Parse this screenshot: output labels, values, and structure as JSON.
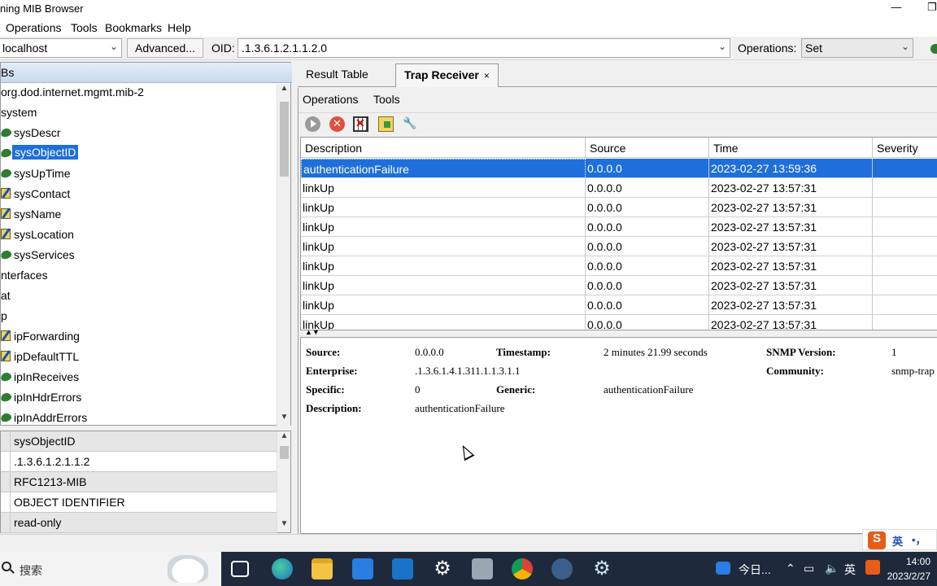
{
  "window": {
    "title": "ning MIB Browser",
    "minimize": "—",
    "maximize": "❐"
  },
  "menu": [
    "Operations",
    "Tools",
    "Bookmarks",
    "Help"
  ],
  "toolbar": {
    "host": "localhost",
    "advanced_label": "Advanced...",
    "oid_label": "OID:",
    "oid_value": ".1.3.6.1.2.1.1.2.0",
    "operations_label": "Operations:",
    "operations_value": "Set"
  },
  "tree": {
    "header": "Bs",
    "items": [
      {
        "label": "org.dod.internet.mgmt.mib-2",
        "icon": "none"
      },
      {
        "label": "system",
        "icon": "none"
      },
      {
        "label": "sysDescr",
        "icon": "leaf-icon"
      },
      {
        "label": "sysObjectID",
        "icon": "leaf-icon",
        "selected": true
      },
      {
        "label": "sysUpTime",
        "icon": "leaf-icon"
      },
      {
        "label": "sysContact",
        "icon": "edit-icon"
      },
      {
        "label": "sysName",
        "icon": "edit-icon"
      },
      {
        "label": "sysLocation",
        "icon": "edit-icon"
      },
      {
        "label": "sysServices",
        "icon": "leaf-icon"
      },
      {
        "label": "nterfaces",
        "icon": "none"
      },
      {
        "label": "at",
        "icon": "none"
      },
      {
        "label": "p",
        "icon": "none"
      },
      {
        "label": "ipForwarding",
        "icon": "edit-icon"
      },
      {
        "label": "ipDefaultTTL",
        "icon": "edit-icon"
      },
      {
        "label": "ipInReceives",
        "icon": "leaf-icon"
      },
      {
        "label": "ipInHdrErrors",
        "icon": "leaf-icon"
      },
      {
        "label": "ipInAddrErrors",
        "icon": "leaf-icon"
      }
    ]
  },
  "properties": [
    "sysObjectID",
    ".1.3.6.1.2.1.1.2",
    "RFC1213-MIB",
    "OBJECT IDENTIFIER",
    "read-only"
  ],
  "tabs": [
    {
      "label": "Result Table"
    },
    {
      "label": "Trap Receiver",
      "close": "×"
    }
  ],
  "submenu": [
    "Operations",
    "Tools"
  ],
  "icons": [
    "play-icon",
    "stop-icon",
    "clear-table-icon",
    "load-icon",
    "settings-wrench-icon"
  ],
  "trap_table": {
    "columns": [
      "Description",
      "Source",
      "Time",
      "Severity"
    ],
    "rows": [
      {
        "description": "authenticationFailure",
        "source": "0.0.0.0",
        "time": "2023-02-27 13:59:36",
        "severity": ""
      },
      {
        "description": "linkUp",
        "source": "0.0.0.0",
        "time": "2023-02-27 13:57:31",
        "severity": ""
      },
      {
        "description": "linkUp",
        "source": "0.0.0.0",
        "time": "2023-02-27 13:57:31",
        "severity": ""
      },
      {
        "description": "linkUp",
        "source": "0.0.0.0",
        "time": "2023-02-27 13:57:31",
        "severity": ""
      },
      {
        "description": "linkUp",
        "source": "0.0.0.0",
        "time": "2023-02-27 13:57:31",
        "severity": ""
      },
      {
        "description": "linkUp",
        "source": "0.0.0.0",
        "time": "2023-02-27 13:57:31",
        "severity": ""
      },
      {
        "description": "linkUp",
        "source": "0.0.0.0",
        "time": "2023-02-27 13:57:31",
        "severity": ""
      },
      {
        "description": "linkUp",
        "source": "0.0.0.0",
        "time": "2023-02-27 13:57:31",
        "severity": ""
      },
      {
        "description": "linkUp",
        "source": "0.0.0.0",
        "time": "2023-02-27 13:57:31",
        "severity": ""
      }
    ]
  },
  "detail": {
    "source_label": "Source:",
    "source": "0.0.0.0",
    "timestamp_label": "Timestamp:",
    "timestamp": "2 minutes 21.99 seconds",
    "snmp_version_label": "SNMP Version:",
    "snmp_version": "1",
    "enterprise_label": "Enterprise:",
    "enterprise": ".1.3.6.1.4.1.311.1.1.3.1.1",
    "community_label": "Community:",
    "community": "snmp-trap",
    "specific_label": "Specific:",
    "specific": "0",
    "generic_label": "Generic:",
    "generic": "authenticationFailure",
    "description_label": "Description:",
    "description": "authenticationFailure"
  },
  "ime": {
    "s": "S",
    "lang": "英",
    "punct": "•，"
  },
  "taskbar": {
    "search_placeholder": "搜索",
    "weather": "今日...",
    "input_lang": "英",
    "time": "14:00",
    "date": "2023/2/27"
  }
}
